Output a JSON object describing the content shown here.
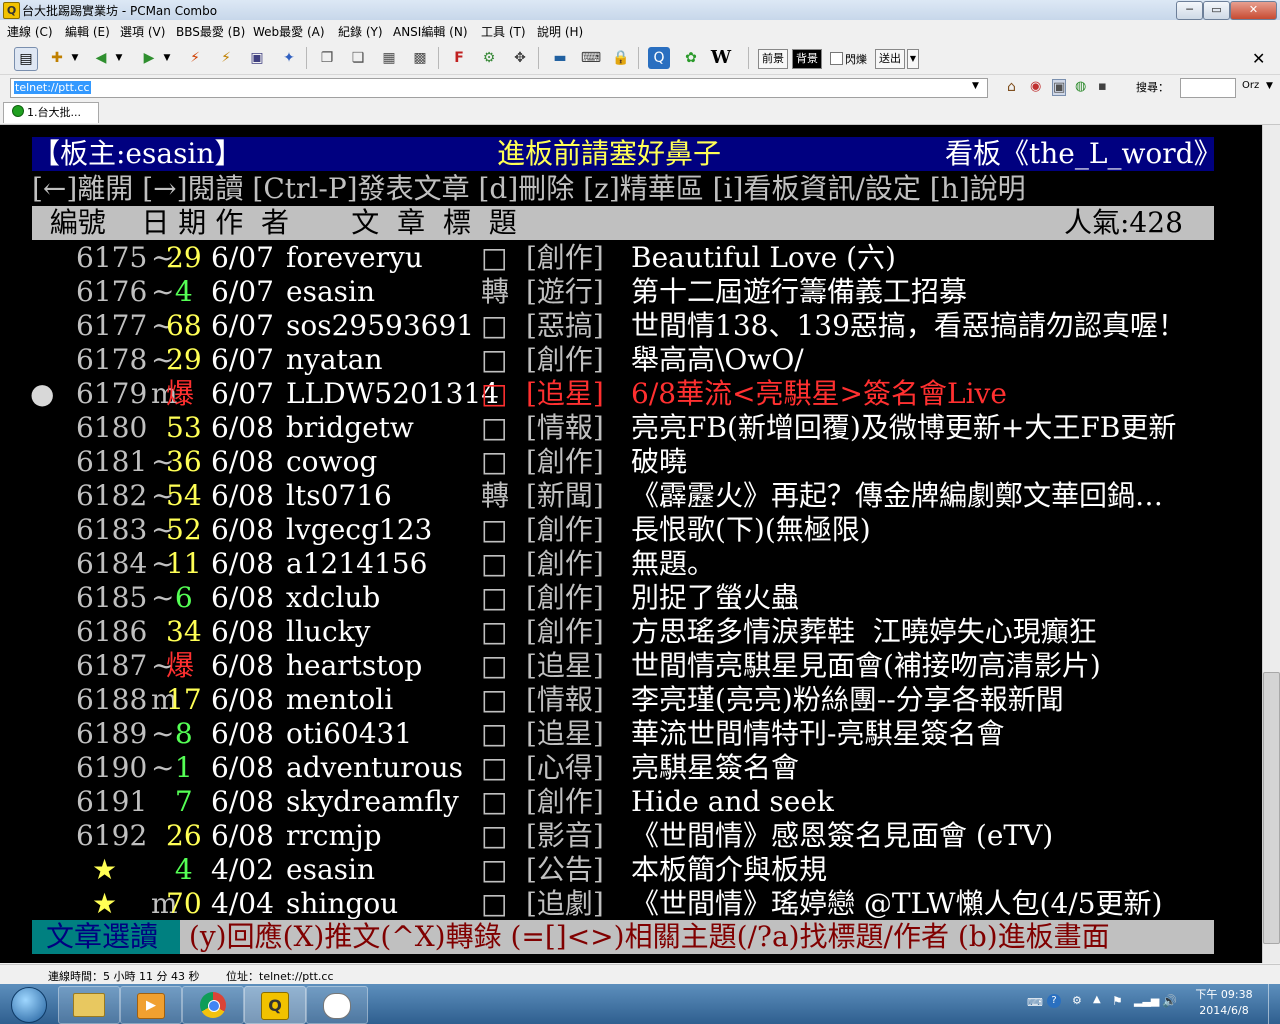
{
  "window": {
    "title": "台大批踢踢實業坊 - PCMan Combo",
    "icon_glyph": "Q",
    "controls": {
      "minimize": "─",
      "maximize": "▭",
      "close": "✕"
    }
  },
  "menu": [
    "連線 (C)",
    "編輯 (E)",
    "選項 (V)",
    "BBS最愛 (B)",
    "Web最愛 (A)",
    "紀錄 (Y)",
    "ANSI編輯 (N)",
    "工具 (T)",
    "說明 (H)"
  ],
  "toolbar": {
    "fg_label": "前景",
    "bg_label": "背景",
    "blink_label": "閃爍",
    "send_label": "送出",
    "search_label": "搜尋：",
    "orz_label": "Orz",
    "close_glyph": "✕"
  },
  "address": {
    "url": "telnet://ptt.cc"
  },
  "tab": {
    "label": "1.台大批..."
  },
  "terminal": {
    "header": {
      "moderator": "【板主:esasin】",
      "title": "進板前請塞好鼻子",
      "board": "看板《the_L_word》"
    },
    "help_line": "[←]離開 [→]閱讀 [Ctrl-P]發表文章 [d]刪除 [z]精華區 [i]看板資訊/設定 [h]說明",
    "columns": {
      "header": "  編號    日 期 作  者       文  章  標  題",
      "popularity": "人氣:428"
    },
    "cursor": "●",
    "rows": [
      {
        "num": "6175",
        "mark": "~",
        "score": "29",
        "date": "6/07",
        "author": "foreveryu",
        "box": "□",
        "category": "[創作]",
        "title": "Beautiful Love (六)"
      },
      {
        "num": "6176",
        "mark": "~",
        "score": " 4",
        "date": "6/07",
        "author": "esasin",
        "box": "轉",
        "category": "[遊行]",
        "title": "第十二屆遊行籌備義工招募"
      },
      {
        "num": "6177",
        "mark": "~",
        "score": "68",
        "date": "6/07",
        "author": "sos29593691",
        "box": "□",
        "category": "[惡搞]",
        "title": "世間情138、139惡搞，看惡搞請勿認真喔！"
      },
      {
        "num": "6178",
        "mark": "~",
        "score": "29",
        "date": "6/07",
        "author": "nyatan",
        "box": "□",
        "category": "[創作]",
        "title": "舉高高\\OwO/"
      },
      {
        "num": "6179",
        "mark": "m",
        "score": "爆",
        "date": "6/07",
        "author": "LLDW5201314",
        "box": "□",
        "category": "[追星]",
        "title": "6/8華流<亮騏星>簽名會Live"
      },
      {
        "num": "6180",
        "mark": " ",
        "score": "53",
        "date": "6/08",
        "author": "bridgetw",
        "box": "□",
        "category": "[情報]",
        "title": "亮亮FB(新增回覆)及微博更新+大王FB更新"
      },
      {
        "num": "6181",
        "mark": "~",
        "score": "36",
        "date": "6/08",
        "author": "cowog",
        "box": "□",
        "category": "[創作]",
        "title": "破曉"
      },
      {
        "num": "6182",
        "mark": "~",
        "score": "54",
        "date": "6/08",
        "author": "lts0716",
        "box": "轉",
        "category": "[新聞]",
        "title": "《霹靂火》再起？傳金牌編劇鄭文華回鍋…"
      },
      {
        "num": "6183",
        "mark": "~",
        "score": "52",
        "date": "6/08",
        "author": "lvgecg123",
        "box": "□",
        "category": "[創作]",
        "title": "長恨歌(下)(無極限)"
      },
      {
        "num": "6184",
        "mark": "~",
        "score": "11",
        "date": "6/08",
        "author": "a1214156",
        "box": "□",
        "category": "[創作]",
        "title": "無題。"
      },
      {
        "num": "6185",
        "mark": "~",
        "score": " 6",
        "date": "6/08",
        "author": "xdclub",
        "box": "□",
        "category": "[創作]",
        "title": "別捉了螢火蟲"
      },
      {
        "num": "6186",
        "mark": " ",
        "score": "34",
        "date": "6/08",
        "author": "llucky",
        "box": "□",
        "category": "[創作]",
        "title": "方思瑤多情淚葬鞋  江曉婷失心現癲狂"
      },
      {
        "num": "6187",
        "mark": "~",
        "score": "爆",
        "date": "6/08",
        "author": "heartstop",
        "box": "□",
        "category": "[追星]",
        "title": "世間情亮騏星見面會(補接吻高清影片)"
      },
      {
        "num": "6188",
        "mark": "m",
        "score": "17",
        "date": "6/08",
        "author": "mentoli",
        "box": "□",
        "category": "[情報]",
        "title": "李亮瑾(亮亮)粉絲團--分享各報新聞"
      },
      {
        "num": "6189",
        "mark": "~",
        "score": " 8",
        "date": "6/08",
        "author": "oti60431",
        "box": "□",
        "category": "[追星]",
        "title": "華流世間情特刊-亮騏星簽名會"
      },
      {
        "num": "6190",
        "mark": "~",
        "score": " 1",
        "date": "6/08",
        "author": "adventurous",
        "box": "□",
        "category": "[心得]",
        "title": "亮騏星簽名會"
      },
      {
        "num": "6191",
        "mark": " ",
        "score": " 7",
        "date": "6/08",
        "author": "skydreamfly",
        "box": "□",
        "category": "[創作]",
        "title": "Hide and seek"
      },
      {
        "num": "6192",
        "mark": " ",
        "score": "26",
        "date": "6/08",
        "author": "rrcmjp",
        "box": "□",
        "category": "[影音]",
        "title": "《世間情》感恩簽名見面會 (eTV)"
      },
      {
        "num": "★",
        "mark": " ",
        "score": " 4",
        "date": "4/02",
        "author": "esasin",
        "box": "□",
        "category": "[公告]",
        "title": "本板簡介與板規"
      },
      {
        "num": "★",
        "mark": "m",
        "score": "70",
        "date": "4/04",
        "author": "shingou",
        "box": "□",
        "category": "[追劇]",
        "title": "《世間情》瑤婷戀 @TLW懶人包(4/5更新)"
      }
    ],
    "footer": {
      "mode": "文章選讀",
      "keys": " (y)回應(X)推文(^X)轉錄 (=[]<>)相關主題(/?a)找標題/作者 (b)進板畫面"
    }
  },
  "statusbar": {
    "connected": "連線時間：5 小時 11 分 43 秒",
    "address": "位址：telnet://ptt.cc"
  },
  "taskbar": {
    "time": "下午 09:38",
    "date": "2014/6/8"
  },
  "colors": {
    "terminal_bg": "#000000",
    "header_bg": "#000080",
    "bar_gray": "#c0c0c0",
    "yellow": "#ffff55",
    "green": "#55ff55",
    "red": "#ff3030",
    "cyan": "#33d0d0"
  }
}
